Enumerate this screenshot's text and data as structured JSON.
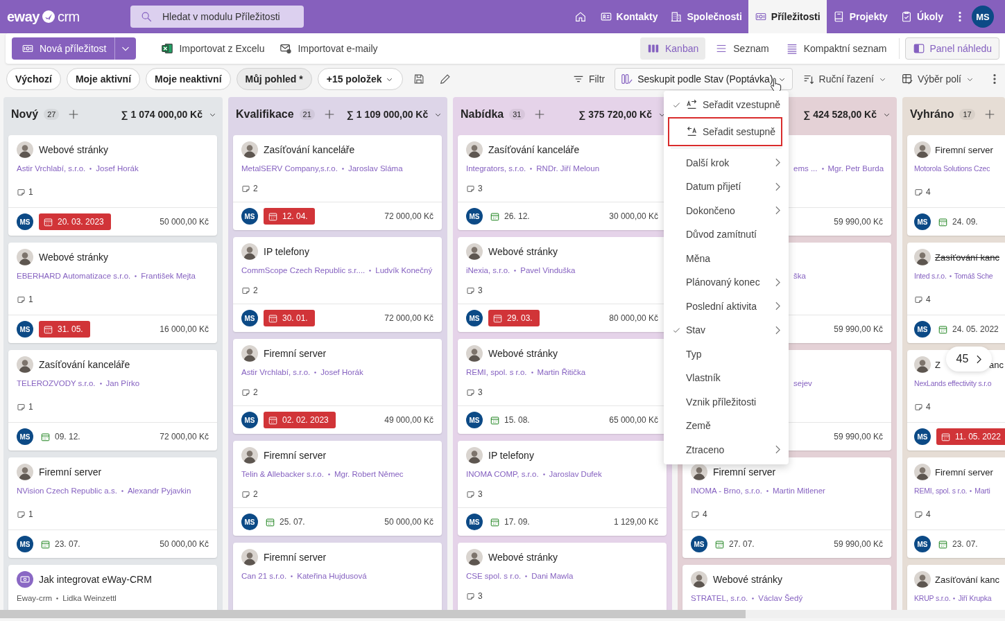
{
  "header": {
    "logo": {
      "left": "eway",
      "right": "crm"
    },
    "search": {
      "placeholder": "Hledat v modulu Příležitosti"
    },
    "nav": [
      {
        "label": "Kontakty",
        "selected": false
      },
      {
        "label": "Společnosti",
        "selected": false
      },
      {
        "label": "Příležitosti",
        "selected": true
      },
      {
        "label": "Projekty",
        "selected": false
      },
      {
        "label": "Úkoly",
        "selected": false
      }
    ],
    "user": "MS"
  },
  "toolbar": {
    "new_button": "Nová příležitost",
    "imports": [
      "Importovat z Excelu",
      "Importovat e-maily"
    ],
    "views": [
      {
        "label": "Kanban",
        "selected": true
      },
      {
        "label": "Seznam",
        "selected": false
      },
      {
        "label": "Kompaktní seznam",
        "selected": false
      }
    ],
    "preview_button": "Panel náhledu"
  },
  "filters": {
    "views": [
      {
        "label": "Výchozí",
        "selected": false
      },
      {
        "label": "Moje aktivní",
        "selected": false
      },
      {
        "label": "Moje neaktivní",
        "selected": false
      },
      {
        "label": "Můj pohled *",
        "selected": true
      }
    ],
    "more": "+15 položek",
    "filter": "Filtr",
    "group_by": "Seskupit podle Stav (Poptávka)",
    "sort": "Ruční řazení",
    "fields": "Výběr polí"
  },
  "menu": {
    "sort_items": [
      {
        "label": "Seřadit vzestupně",
        "checked": true,
        "outlined": false
      },
      {
        "label": "Seřadit sestupně",
        "checked": false,
        "outlined": true
      }
    ],
    "items": [
      {
        "label": "Další krok",
        "checked": false,
        "submenu": true
      },
      {
        "label": "Datum přijetí",
        "checked": false,
        "submenu": true
      },
      {
        "label": "Dokončeno",
        "checked": false,
        "submenu": true
      },
      {
        "label": "Důvod zamítnutí",
        "checked": false,
        "submenu": false
      },
      {
        "label": "Měna",
        "checked": false,
        "submenu": false
      },
      {
        "label": "Plánovaný konec",
        "checked": false,
        "submenu": true
      },
      {
        "label": "Poslední aktivita",
        "checked": false,
        "submenu": true
      },
      {
        "label": "Stav",
        "checked": true,
        "submenu": true
      },
      {
        "label": "Typ",
        "checked": false,
        "submenu": false
      },
      {
        "label": "Vlastník",
        "checked": false,
        "submenu": false
      },
      {
        "label": "Vznik příležitosti",
        "checked": false,
        "submenu": false
      },
      {
        "label": "Země",
        "checked": false,
        "submenu": false
      },
      {
        "label": "Ztraceno",
        "checked": false,
        "submenu": true
      }
    ]
  },
  "columns": [
    {
      "name": "Nový",
      "count": "27",
      "total": "∑ 1 074 000,00 Kč",
      "color": "#e3e6e9",
      "cards": [
        {
          "kind": "person",
          "title": "Webové stránky",
          "struck": false,
          "linked": true,
          "company": "Astir Vrchlabí, s.r.o.",
          "contact": "Josef Horák",
          "comments": "1",
          "owner": "MS",
          "date": "20. 03. 2023",
          "overdue": true,
          "amount": "50 000,00 Kč"
        },
        {
          "kind": "person",
          "title": "Webové stránky",
          "struck": false,
          "linked": true,
          "company": "EBERHARD Automatizace s.r.o.",
          "contact": "František Mejta",
          "comments": "1",
          "owner": "MS",
          "date": "31. 05.",
          "overdue": true,
          "amount": "16 000,00 Kč"
        },
        {
          "kind": "person",
          "title": "Zasíťování kanceláře",
          "struck": false,
          "linked": true,
          "company": "TELEROZVODY s.r.o.",
          "contact": "Jan Pírko",
          "comments": "1",
          "owner": "MS",
          "date": "09. 12.",
          "overdue": false,
          "amount": "72 000,00 Kč"
        },
        {
          "kind": "person",
          "title": "Firemní server",
          "struck": false,
          "linked": true,
          "company": "NVision Czech Republic a.s.",
          "contact": "Alexandr Pyjavkin",
          "comments": "1",
          "owner": "MS",
          "date": "23. 07.",
          "overdue": false,
          "amount": "50 000,00 Kč"
        },
        {
          "kind": "icon",
          "title": "Jak integrovat eWay-CRM",
          "struck": false,
          "linked": false,
          "company": "Eway-crm",
          "contact": "Lidka Weinzettl"
        }
      ]
    },
    {
      "name": "Kvalifikace",
      "count": "21",
      "total": "∑ 1 109 000,00 Kč",
      "color": "#ddd5e8",
      "cards": [
        {
          "kind": "person",
          "title": "Zasíťování kanceláře",
          "struck": false,
          "linked": true,
          "company": "MetalSERV Company,s.r.o.",
          "contact": "Jaroslav Sláma",
          "comments": "2",
          "owner": "MS",
          "date": "12. 04.",
          "overdue": true,
          "amount": "72 000,00 Kč"
        },
        {
          "kind": "person",
          "title": "IP telefony",
          "struck": false,
          "linked": true,
          "company": "CommScope Czech Republic s.r....",
          "contact": "Ludvík Konečný",
          "comments": "2",
          "owner": "MS",
          "date": "30. 01.",
          "overdue": true,
          "amount": "72 000,00 Kč"
        },
        {
          "kind": "person",
          "title": "Firemní server",
          "struck": false,
          "linked": true,
          "company": "Astir Vrchlabí, s.r.o.",
          "contact": "Josef Horák",
          "comments": "2",
          "owner": "MS",
          "date": "02. 02. 2023",
          "overdue": true,
          "amount": "49 000,00 Kč"
        },
        {
          "kind": "person",
          "title": "Firemní server",
          "struck": false,
          "linked": true,
          "company": "Telin & Allebacker s.r.o.",
          "contact": "Mgr. Robert Němec",
          "comments": "2",
          "owner": "MS",
          "date": "25. 07.",
          "overdue": false,
          "amount": "50 000,00 Kč"
        },
        {
          "kind": "person",
          "title": "Firemní server",
          "struck": false,
          "linked": true,
          "company": "Can 21 s.r.o.",
          "contact": "Kateřina Hujdusová"
        }
      ]
    },
    {
      "name": "Nabídka",
      "count": "31",
      "total": "∑ 375 720,00 Kč",
      "color": "#e5d3e9",
      "cards": [
        {
          "kind": "person",
          "title": "Zasíťování kanceláře",
          "struck": false,
          "linked": true,
          "company": "Integrators, s.r.o.",
          "contact": "RNDr. Jiří Meloun",
          "comments": "3",
          "owner": "MS",
          "date": "26. 12.",
          "overdue": false,
          "amount": "30 000,00 Kč"
        },
        {
          "kind": "person",
          "title": "Webové stránky",
          "struck": false,
          "linked": true,
          "company": "iNexia, s.r.o.",
          "contact": "Pavel Vinduška",
          "comments": "3",
          "owner": "MS",
          "date": "29. 03.",
          "overdue": true,
          "amount": "80 000,00 Kč"
        },
        {
          "kind": "person",
          "title": "Webové stránky",
          "struck": false,
          "linked": true,
          "company": "REMI, spol. s r.o.",
          "contact": "Martin Řitička",
          "comments": "3",
          "owner": "MS",
          "date": "15. 08.",
          "overdue": false,
          "amount": "65 000,00 Kč"
        },
        {
          "kind": "person",
          "title": "IP telefony",
          "struck": false,
          "linked": true,
          "company": "INOMA COMP, s.r.o.",
          "contact": "Jaroslav Dufek",
          "comments": "3",
          "owner": "MS",
          "date": "17. 09.",
          "overdue": false,
          "amount": "1 129,00 Kč"
        },
        {
          "kind": "person",
          "title": "Webové stránky",
          "struck": false,
          "linked": true,
          "company": "CSE spol. s r.o.",
          "contact": "Dani Mawla",
          "comments": "3"
        }
      ]
    },
    {
      "total": "∑ 424 528,00 Kč",
      "color": "#e4d1d6",
      "cards": [
        {
          "kind": "partial",
          "linked": true,
          "company": "ems ...",
          "contact": "Mgr. Petr Burda",
          "amount": "59 990,00 Kč"
        },
        {
          "kind": "partial",
          "linked": true,
          "contact": "ška",
          "amount": "59 990,00 Kč"
        },
        {
          "kind": "partial",
          "linked": true,
          "contact": "sejev",
          "amount": "59 990,00 Kč"
        },
        {
          "kind": "person",
          "title": "Firemní server",
          "struck": false,
          "linked": true,
          "company": "INOMA - Brno, s.r.o.",
          "contact": "Martin Mitlener",
          "comments": "4",
          "owner": "MS",
          "date": "27. 07.",
          "overdue": false,
          "amount": "59 990,00 Kč"
        },
        {
          "kind": "person",
          "title": "Webové stránky",
          "struck": false,
          "linked": true,
          "company": "STRATEL, s.r.o.",
          "contact": "Václav Šedý"
        }
      ]
    },
    {
      "name": "Vyhráno",
      "count": "17",
      "color": "#e6ddd5",
      "cards": [
        {
          "kind": "person",
          "title": "Firemní server",
          "struck": false,
          "linked": true,
          "company": "Motorola Solutions Czec",
          "comments": "4",
          "owner": "MS",
          "date": "24. 09.",
          "overdue": false
        },
        {
          "kind": "person",
          "title": "Zasíťování kanc",
          "struck": true,
          "linked": true,
          "company": "Inted s.r.o.",
          "contact": "Tomáš Sche",
          "comments": "4",
          "owner": "MS",
          "date": "24. 05. 2022",
          "overdue": false
        },
        {
          "kind": "person",
          "title": "Z",
          "title_tail": "anc",
          "struck": false,
          "linked": true,
          "company": "NexLands effectivity s.r.o",
          "comments": "4",
          "owner": "MS",
          "date": "11. 05. 2022",
          "overdue": true
        },
        {
          "kind": "person",
          "title": "Firemní server",
          "struck": false,
          "linked": true,
          "company": "REMI, spol. s r.o.",
          "contact": "Marti",
          "comments": "4",
          "owner": "MS",
          "date": "23. 07.",
          "overdue": false
        },
        {
          "kind": "person",
          "title": "Zasíťování kanc",
          "struck": false,
          "linked": true,
          "company": "KRUP s.r.o.",
          "contact": "Jiří Krupka"
        }
      ]
    }
  ],
  "pager": {
    "count": "45"
  }
}
